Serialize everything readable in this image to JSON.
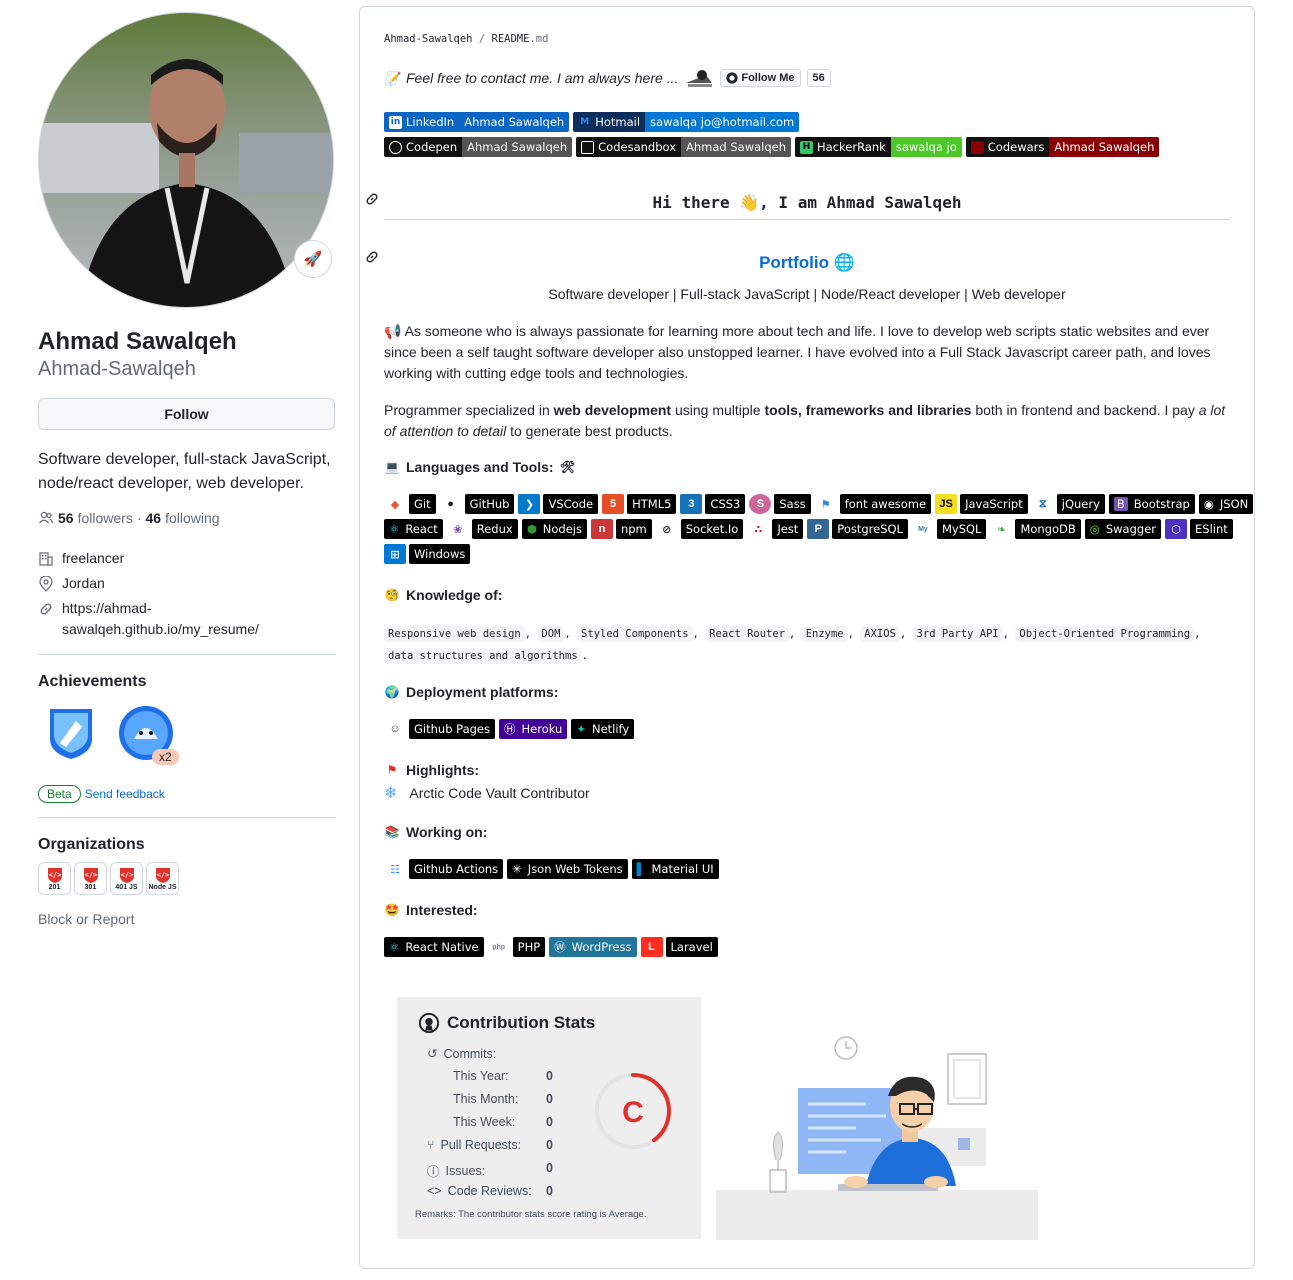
{
  "profile": {
    "fullname": "Ahmad Sawalqeh",
    "login": "Ahmad-Sawalqeh",
    "follow_label": "Follow",
    "bio": "Software developer, full-stack JavaScript, node/react developer, web developer.",
    "followers_count": "56",
    "followers_label": "followers",
    "following_count": "46",
    "following_label": "following",
    "company": "freelancer",
    "location": "Jordan",
    "website_line1": "https://ahmad-",
    "website_line2": "sawalqeh.github.io/my_resume/",
    "status_icon": "rocket-icon"
  },
  "achievements": {
    "title": "Achievements",
    "multiplier": "x2",
    "beta": "Beta",
    "feedback": "Send feedback"
  },
  "organizations": {
    "title": "Organizations",
    "items": [
      "201",
      "301",
      "401 JS",
      "Node JS"
    ]
  },
  "block_report": "Block or Report",
  "readme": {
    "breadcrumb_user": "Ahmad-Sawalqeh",
    "breadcrumb_sep": "/",
    "breadcrumb_file": "README",
    "breadcrumb_ext": ".md",
    "contact_text": "Feel free to contact me. I am always here ...",
    "follow_me": "Follow Me",
    "follow_count": "56",
    "social_badges": [
      {
        "label": "LinkedIn",
        "value": "Ahmad Sawalqeh",
        "color": "#0a66c2"
      },
      {
        "label": "Hotmail",
        "value": "sawalqa jo@hotmail.com",
        "color": "#0078d4"
      },
      {
        "label": "Codepen",
        "value": "Ahmad Sawalqeh",
        "color": "#555555"
      },
      {
        "label": "Codesandbox",
        "value": "Ahmad Sawalqeh",
        "color": "#555555"
      },
      {
        "label": "HackerRank",
        "value": "sawalqa jo",
        "color": "#4bc726"
      },
      {
        "label": "Codewars",
        "value": "Ahmad Sawalqeh",
        "color": "#8b0000"
      }
    ],
    "greeting": "Hi there 👋, I am Ahmad Sawalqeh",
    "portfolio": "Portfolio",
    "tagline": "Software developer | Full-stack JavaScript | Node/React developer | Web developer",
    "about_1": "As someone who is always passionate for learning more about tech and life. I love to develop web scripts static websites and ever since been a self taught software developer also unstopped learner. I have evolved into a Full Stack Javascript career path, and loves working with cutting edge tools and technologies.",
    "about_2_a": "Programmer specialized in ",
    "about_2_b": "web development",
    "about_2_c": " using multiple ",
    "about_2_d": "tools, frameworks and libraries",
    "about_2_e": " both in frontend and backend. I pay ",
    "about_2_f": "a lot of attention to detail",
    "about_2_g": " to generate best products.",
    "languages_title": "Languages and Tools:",
    "tools_row1": [
      "Git",
      "GitHub",
      "VSCode",
      "HTML5",
      "CSS3",
      "Sass",
      "font awesome",
      "JavaScript",
      "jQuery",
      "Bootstrap",
      "JSON"
    ],
    "tools_row2": [
      "React",
      "Redux",
      "Nodejs",
      "npm",
      "Socket.Io",
      "Jest",
      "PostgreSQL",
      "MySQL",
      "MongoDB",
      "Swagger",
      "ESlint"
    ],
    "tools_row3": [
      "Windows"
    ],
    "knowledge_title": "Knowledge of:",
    "knowledge": [
      "Responsive web design",
      "DOM",
      "Styled Components",
      "React Router",
      "Enzyme",
      "AXIOS",
      "3rd Party API",
      "Object-Oriented Programming",
      "data structures and algorithms"
    ],
    "deployment_title": "Deployment platforms:",
    "deployment": [
      "Github Pages",
      "Heroku",
      "Netlify"
    ],
    "highlights_title": "Highlights:",
    "highlight_item": "Arctic Code Vault Contributor",
    "working_title": "Working on:",
    "working": [
      "Github Actions",
      "Json Web Tokens",
      "Material UI"
    ],
    "interested_title": "Interested:",
    "interested": [
      "React Native",
      "PHP",
      "WordPress",
      "Laravel"
    ]
  },
  "stats": {
    "title": "Contribution Stats",
    "commits": "Commits:",
    "this_year": "This Year:",
    "this_month": "This Month:",
    "this_week": "This Week:",
    "pull_requests": "Pull Requests:",
    "issues": "Issues:",
    "code_reviews": "Code Reviews:",
    "values": [
      "0",
      "0",
      "0",
      "0",
      "0",
      "0"
    ],
    "grade": "C",
    "grade_fraction": 0.4,
    "remarks": "Remarks: The contributor stats score rating is Average."
  }
}
